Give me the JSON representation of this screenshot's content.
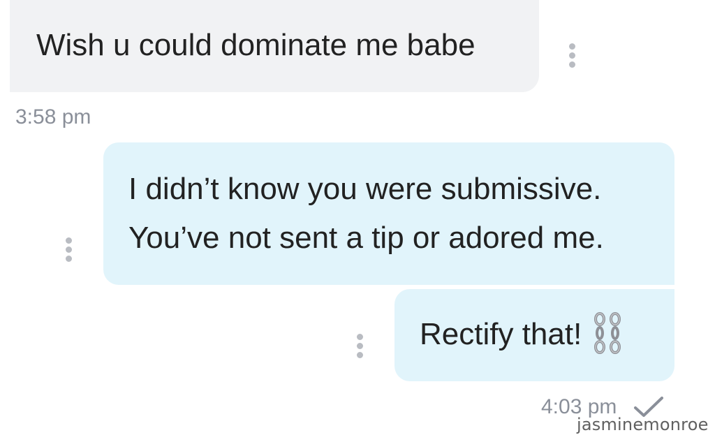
{
  "messages": [
    {
      "direction": "incoming",
      "lines": [
        "Wish u could dominate me babe"
      ],
      "timestamp": "3:58 pm"
    },
    {
      "direction": "outgoing",
      "lines": [
        "I didn’t know you were submissive.",
        "You’ve not sent a tip or adored me."
      ]
    },
    {
      "direction": "outgoing",
      "lines": [
        "Rectify that!"
      ],
      "emoji": "chains-icon",
      "timestamp": "4:03 pm",
      "status_icon": "checkmark-icon"
    }
  ],
  "watermark": "jasminemonroe",
  "colors": {
    "incoming_bubble": "#f1f2f4",
    "outgoing_bubble": "#e1f4fb",
    "message_text": "#222222",
    "timestamp_text": "#8a8f99",
    "kebab_dots": "#b9bcc2"
  }
}
